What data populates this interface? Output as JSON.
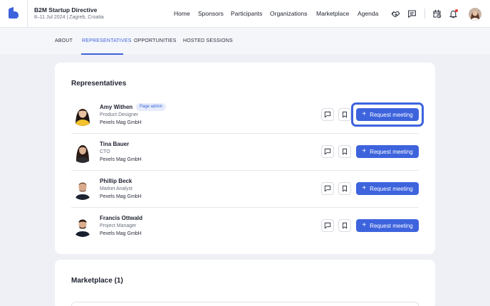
{
  "header": {
    "event_title": "B2M Startup Directive",
    "event_subtitle": "8–11 Jul 2024 | Zagreb, Croatia",
    "nav": [
      "Home",
      "Sponsors",
      "Participants",
      "Organizations",
      "Marketplace",
      "Agenda"
    ],
    "icons": [
      "handshake-icon",
      "chat-icon",
      "calendar-clock-icon",
      "bell-icon"
    ],
    "notification_color": "#e53935"
  },
  "tabs": [
    {
      "label": "ABOUT",
      "active": false
    },
    {
      "label": "REPRESENTATIVES",
      "active": true
    },
    {
      "label": "OPPORTUNITIES",
      "active": false
    },
    {
      "label": "HOSTED SESSIONS",
      "active": false
    }
  ],
  "representatives": {
    "title": "Representatives",
    "items": [
      {
        "name": "Amy Withen",
        "badge": "Page admin",
        "role": "Product Designer",
        "org": "Pexels Mag GmbH",
        "button": "Request meeting",
        "focused": true
      },
      {
        "name": "Tina Bauer",
        "role": "CTO",
        "org": "Pexels Mag GmbH",
        "button": "Request meeting"
      },
      {
        "name": "Phillip Beck",
        "role": "Market Analyst",
        "org": "Pexels Mag GmbH",
        "button": "Request meeting"
      },
      {
        "name": "Francis Ottwald",
        "role": "Project Manager",
        "org": "Pexels Mag GmbH",
        "button": "Request meeting"
      }
    ]
  },
  "marketplace": {
    "title": "Marketplace (1)"
  },
  "colors": {
    "accent": "#3d63dd",
    "background": "#eef0f5",
    "card": "#ffffff"
  }
}
